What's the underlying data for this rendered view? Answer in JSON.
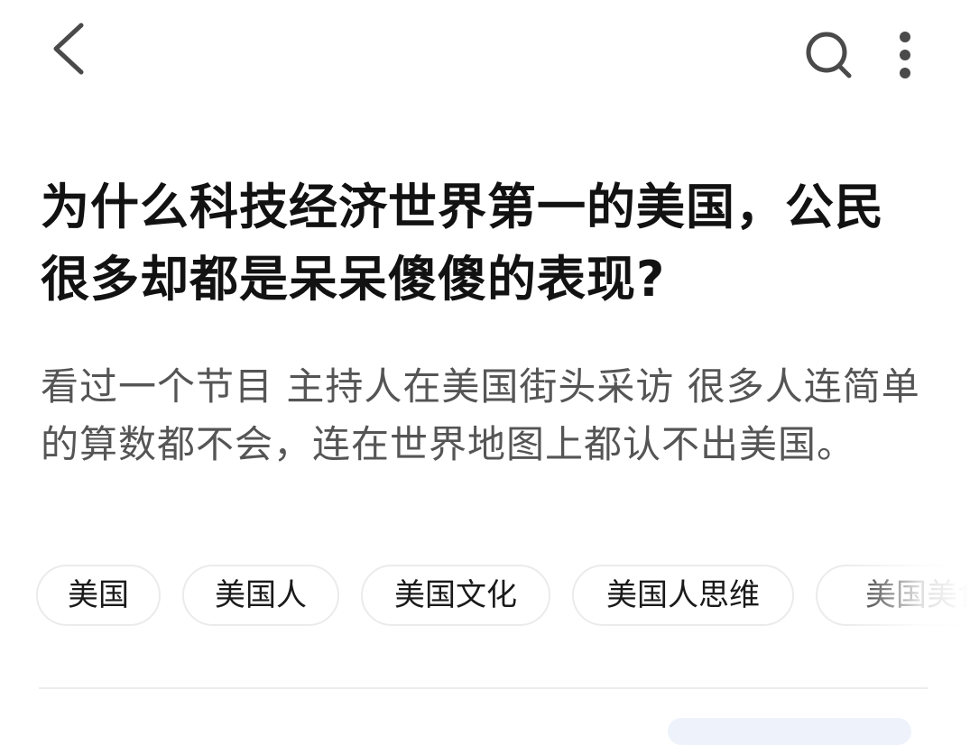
{
  "topbar": {
    "back_icon": "chevron-left-icon",
    "search_icon": "search-icon",
    "more_icon": "more-vertical-icon"
  },
  "question": {
    "title": "为什么科技经济世界第一的美国，公民很多却都是呆呆傻傻的表现?",
    "description": "看过一个节目 主持人在美国街头采访 很多人连简单的算数都不会，连在世界地图上都认不出美国。"
  },
  "tags": [
    {
      "label": "美国"
    },
    {
      "label": "美国人"
    },
    {
      "label": "美国文化"
    },
    {
      "label": "美国人思维"
    },
    {
      "label": "美国美食"
    }
  ],
  "colors": {
    "title": "#121212",
    "description": "#555555",
    "tag_border": "#ebebeb",
    "icon": "#4a4a4a"
  }
}
